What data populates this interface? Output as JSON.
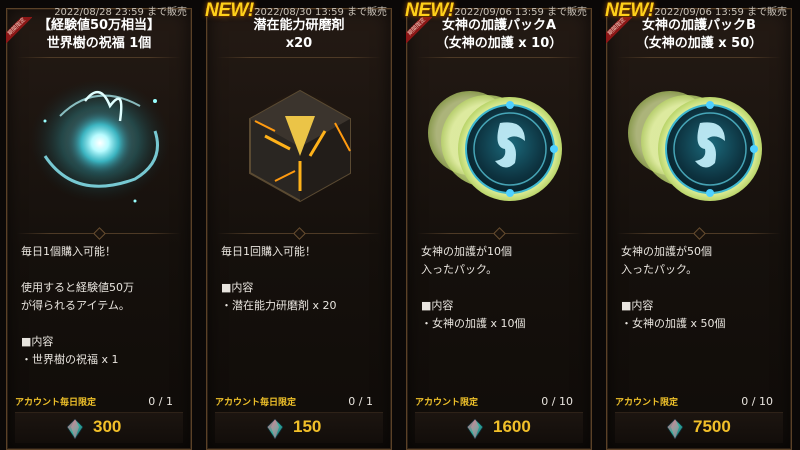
{
  "cards": [
    {
      "new": "",
      "sale_date": "2022/08/28 23:59 まで販売",
      "ribbon": "期間限定",
      "title_line1": "【経験値50万相当】",
      "title_line2": "世界樹の祝福 1個",
      "art_icon": "world-tree-blessing-orb",
      "desc": [
        "毎日1個購入可能！",
        "",
        "使用すると経験値50万",
        "が得られるアイテム。",
        "",
        "■内容",
        "・世界樹の祝福  x 1"
      ],
      "limit_label": "アカウント毎日限定",
      "limit_count": "0 / 1",
      "price": "300"
    },
    {
      "new": "NEW!",
      "sale_date": "2022/08/30 13:59 まで販売",
      "ribbon": "",
      "title_line1": "潜在能力研磨剤",
      "title_line2": "x20",
      "art_icon": "potential-polish-cube",
      "desc": [
        "毎日1回購入可能！",
        "",
        "■内容",
        "・潜在能力研磨剤 x 20"
      ],
      "limit_label": "アカウント毎日限定",
      "limit_count": "0 / 1",
      "price": "150"
    },
    {
      "new": "NEW!",
      "sale_date": "2022/09/06 13:59 まで販売",
      "ribbon": "期間限定",
      "title_line1": "女神の加護パックA",
      "title_line2": "（女神の加護 x 10）",
      "art_icon": "goddess-blessing-coins",
      "desc": [
        "女神の加護が10個",
        "入ったパック。",
        "",
        "■内容",
        "・女神の加護 x 10個"
      ],
      "limit_label": "アカウント限定",
      "limit_count": "0 / 10",
      "price": "1600"
    },
    {
      "new": "NEW!",
      "sale_date": "2022/09/06 13:59 まで販売",
      "ribbon": "期間限定",
      "title_line1": "女神の加護パックB",
      "title_line2": "（女神の加護 x 50）",
      "art_icon": "goddess-blessing-coins",
      "desc": [
        "女神の加護が50個",
        "入ったパック。",
        "",
        "■内容",
        "・女神の加護 x 50個"
      ],
      "limit_label": "アカウント限定",
      "limit_count": "0 / 10",
      "price": "7500"
    }
  ],
  "currency_icon": "gem-icon",
  "colors": {
    "price": "#f2c029",
    "limit": "#f0c22a",
    "new_badge": "#ffd11a",
    "ribbon": "#8c1717"
  }
}
